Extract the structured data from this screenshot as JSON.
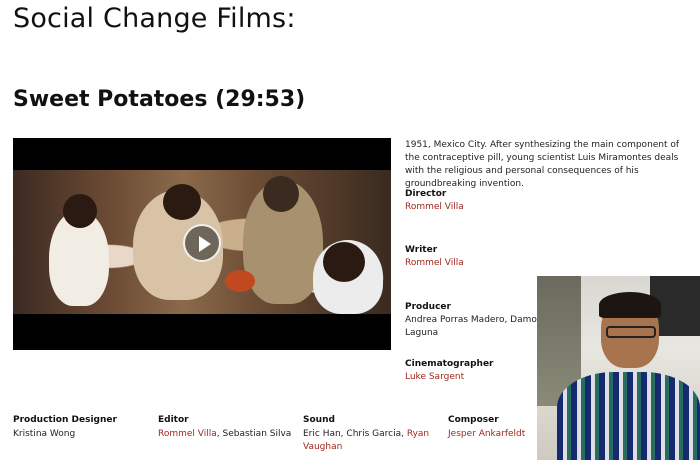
{
  "page": {
    "heading": "Social Change Films:",
    "film_title": "Sweet Potatoes (29:53)"
  },
  "synopsis": "1951, Mexico City. After synthesizing the main component of the contraceptive pill, young scientist Luis Miramontes deals with the religious and personal consequences of his groundbreaking invention.",
  "credits": {
    "director": {
      "label": "Director",
      "name": "Rommel Villa"
    },
    "writer": {
      "label": "Writer",
      "name": "Rommel Villa"
    },
    "producer": {
      "label": "Producer",
      "names_line1": "Andrea Porras Madero, Damon",
      "names_line2": "Laguna"
    },
    "cinematographer": {
      "label": "Cinematographer",
      "name": "Luke Sargent"
    },
    "production_designer": {
      "label": "Production Designer",
      "name": "Kristina Wong"
    },
    "editor": {
      "label": "Editor",
      "name_link": "Rommel Villa",
      "name_rest": ", Sebastian Silva"
    },
    "sound": {
      "label": "Sound",
      "names_text": "Eric Han, Chris Garcia, ",
      "name_link_part1": "Ryan",
      "name_link_part2": "Vaughan"
    },
    "composer": {
      "label": "Composer",
      "name": "Jesper Ankarfeldt"
    }
  },
  "video": {
    "play_icon": "play-icon"
  },
  "colors": {
    "link": "#a0281d",
    "text": "#111111",
    "player_bg": "#000000"
  }
}
